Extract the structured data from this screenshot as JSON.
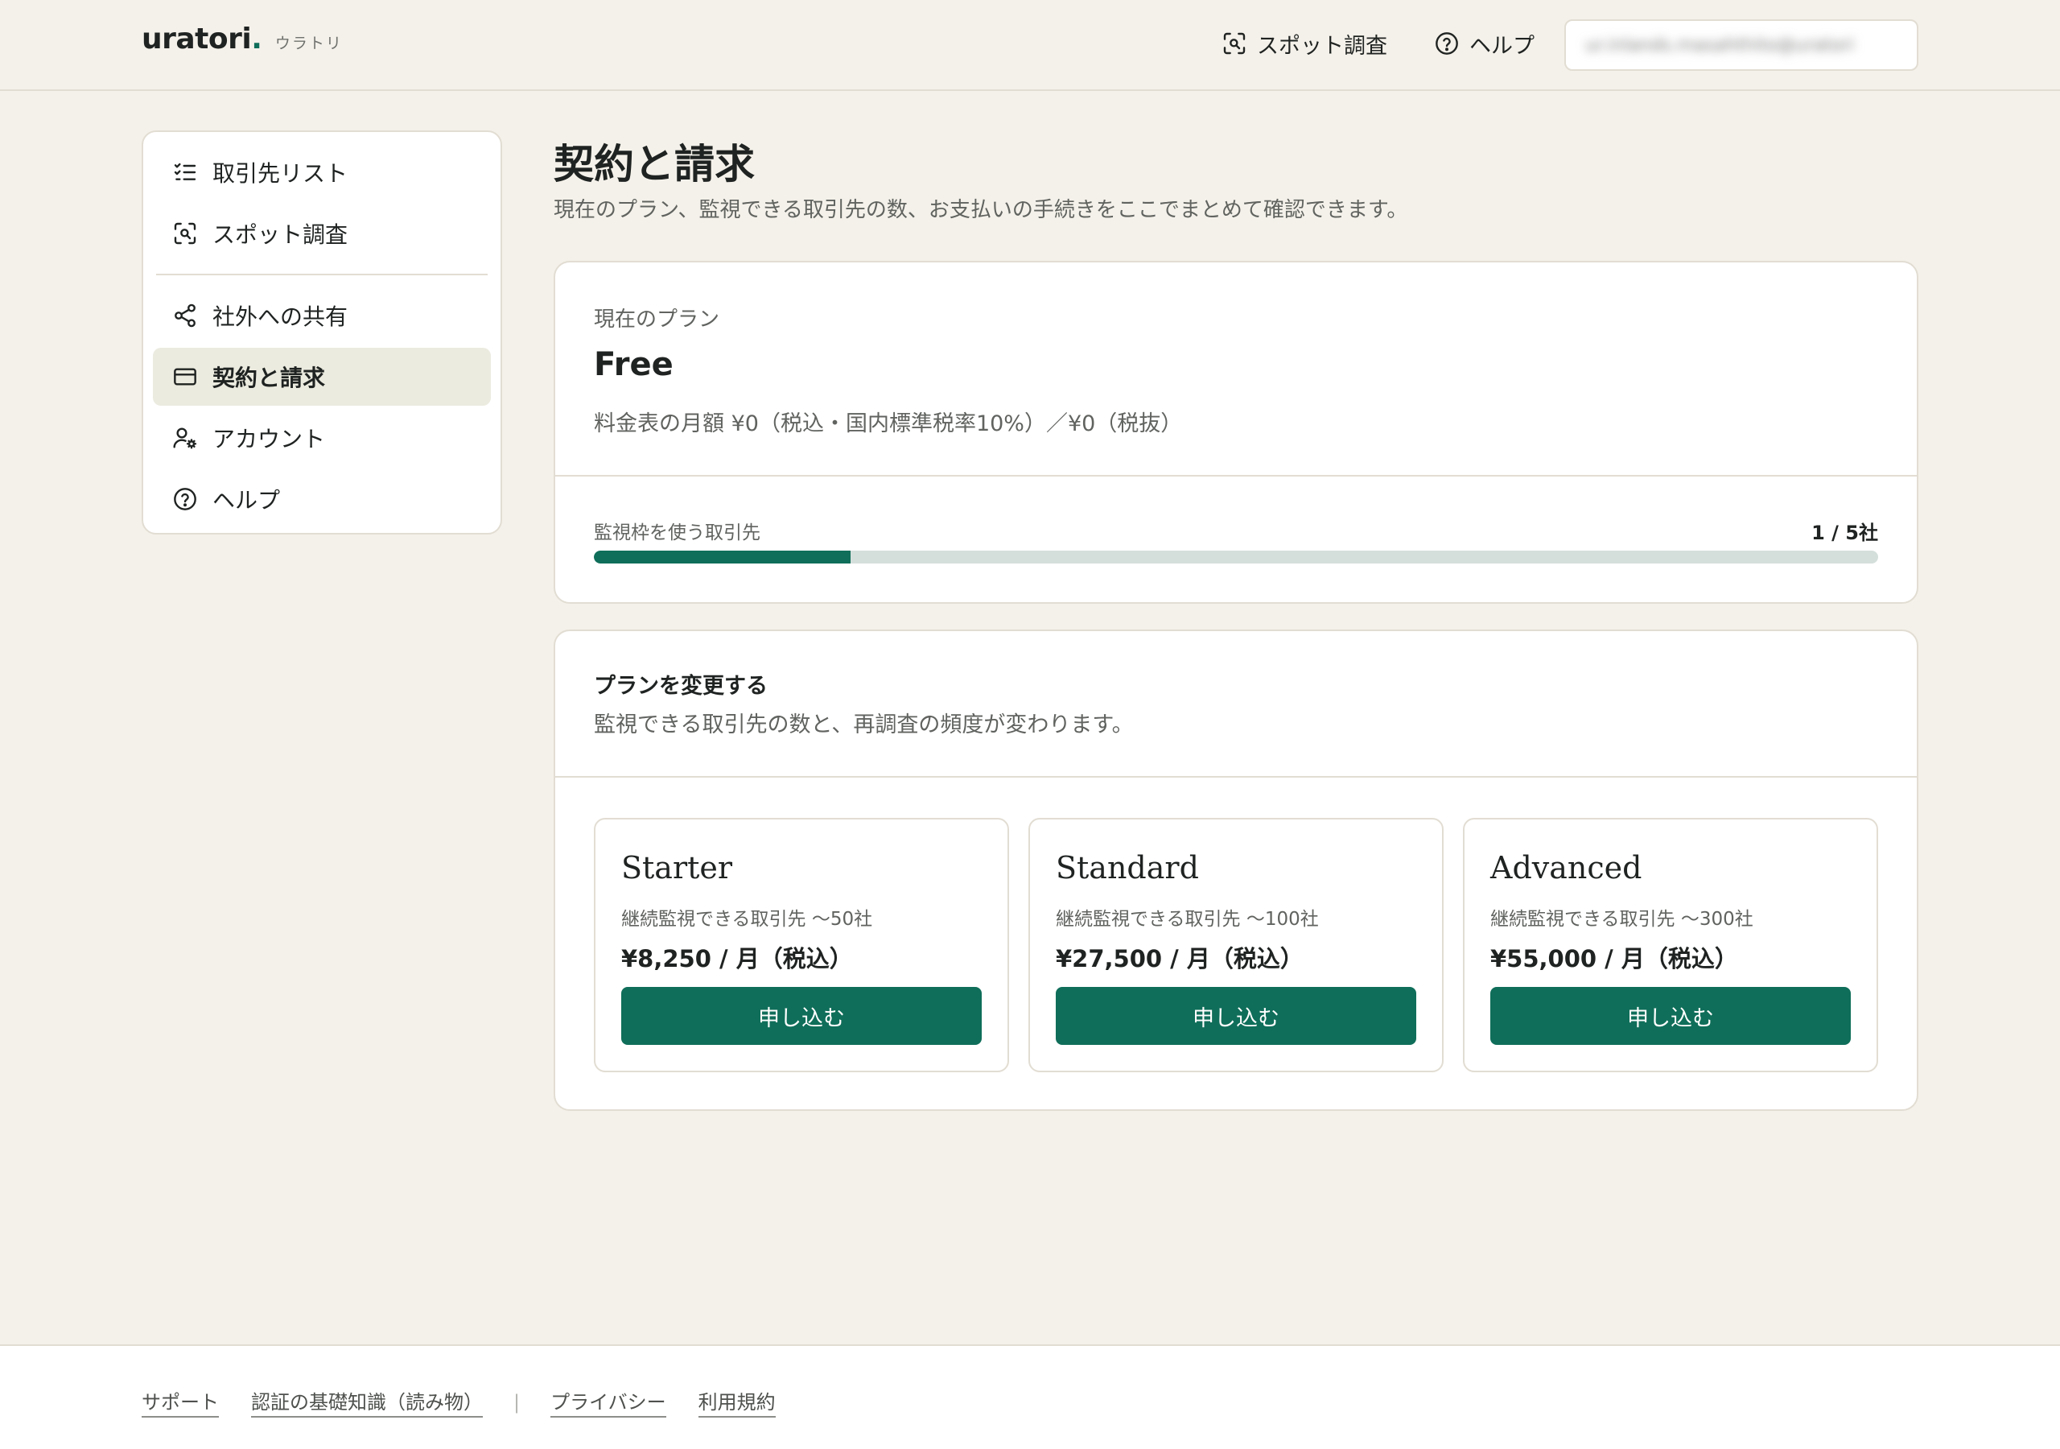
{
  "header": {
    "logo_word": "uratori",
    "logo_dot": ".",
    "logo_kana": "ウラトリ",
    "spot_label": "スポット調査",
    "help_label": "ヘルプ",
    "account_blurred": "ur.inlands.masahthito@uratori"
  },
  "sidebar": {
    "items": [
      {
        "label": "取引先リスト",
        "icon": "checklist-icon"
      },
      {
        "label": "スポット調査",
        "icon": "scan-search-icon"
      },
      {
        "label": "社外への共有",
        "icon": "share-icon"
      },
      {
        "label": "契約と請求",
        "icon": "credit-card-icon",
        "active": true
      },
      {
        "label": "アカウント",
        "icon": "user-settings-icon"
      },
      {
        "label": "ヘルプ",
        "icon": "help-circle-icon"
      }
    ]
  },
  "main": {
    "title": "契約と請求",
    "description": "現在のプラン、監視できる取引先の数、お支払いの手続きをここでまとめて確認できます。",
    "current_plan": {
      "label": "現在のプラン",
      "name": "Free",
      "price_text": "料金表の月額 ¥0（税込・国内標準税率10%）／¥0（税抜）",
      "usage_label": "監視枠を使う取引先",
      "usage_count": "1 / 5社",
      "usage_fraction": 0.2
    },
    "change_plan": {
      "title": "プランを変更する",
      "description": "監視できる取引先の数と、再調査の頻度が変わります。",
      "tiers": [
        {
          "name": "Starter",
          "capacity": "継続監視できる取引先 〜50社",
          "price": "¥8,250 / 月（税込）",
          "button": "申し込む"
        },
        {
          "name": "Standard",
          "capacity": "継続監視できる取引先 〜100社",
          "price": "¥27,500 / 月（税込）",
          "button": "申し込む"
        },
        {
          "name": "Advanced",
          "capacity": "継続監視できる取引先 〜300社",
          "price": "¥55,000 / 月（税込）",
          "button": "申し込む"
        }
      ]
    }
  },
  "footer": {
    "support": "サポート",
    "basics": "認証の基礎知識（読み物）",
    "separator": "|",
    "privacy": "プライバシー",
    "terms": "利用規約"
  },
  "colors": {
    "accent": "#0f6e59",
    "background": "#f4f1ea",
    "progress_track": "#d4dfdb"
  }
}
